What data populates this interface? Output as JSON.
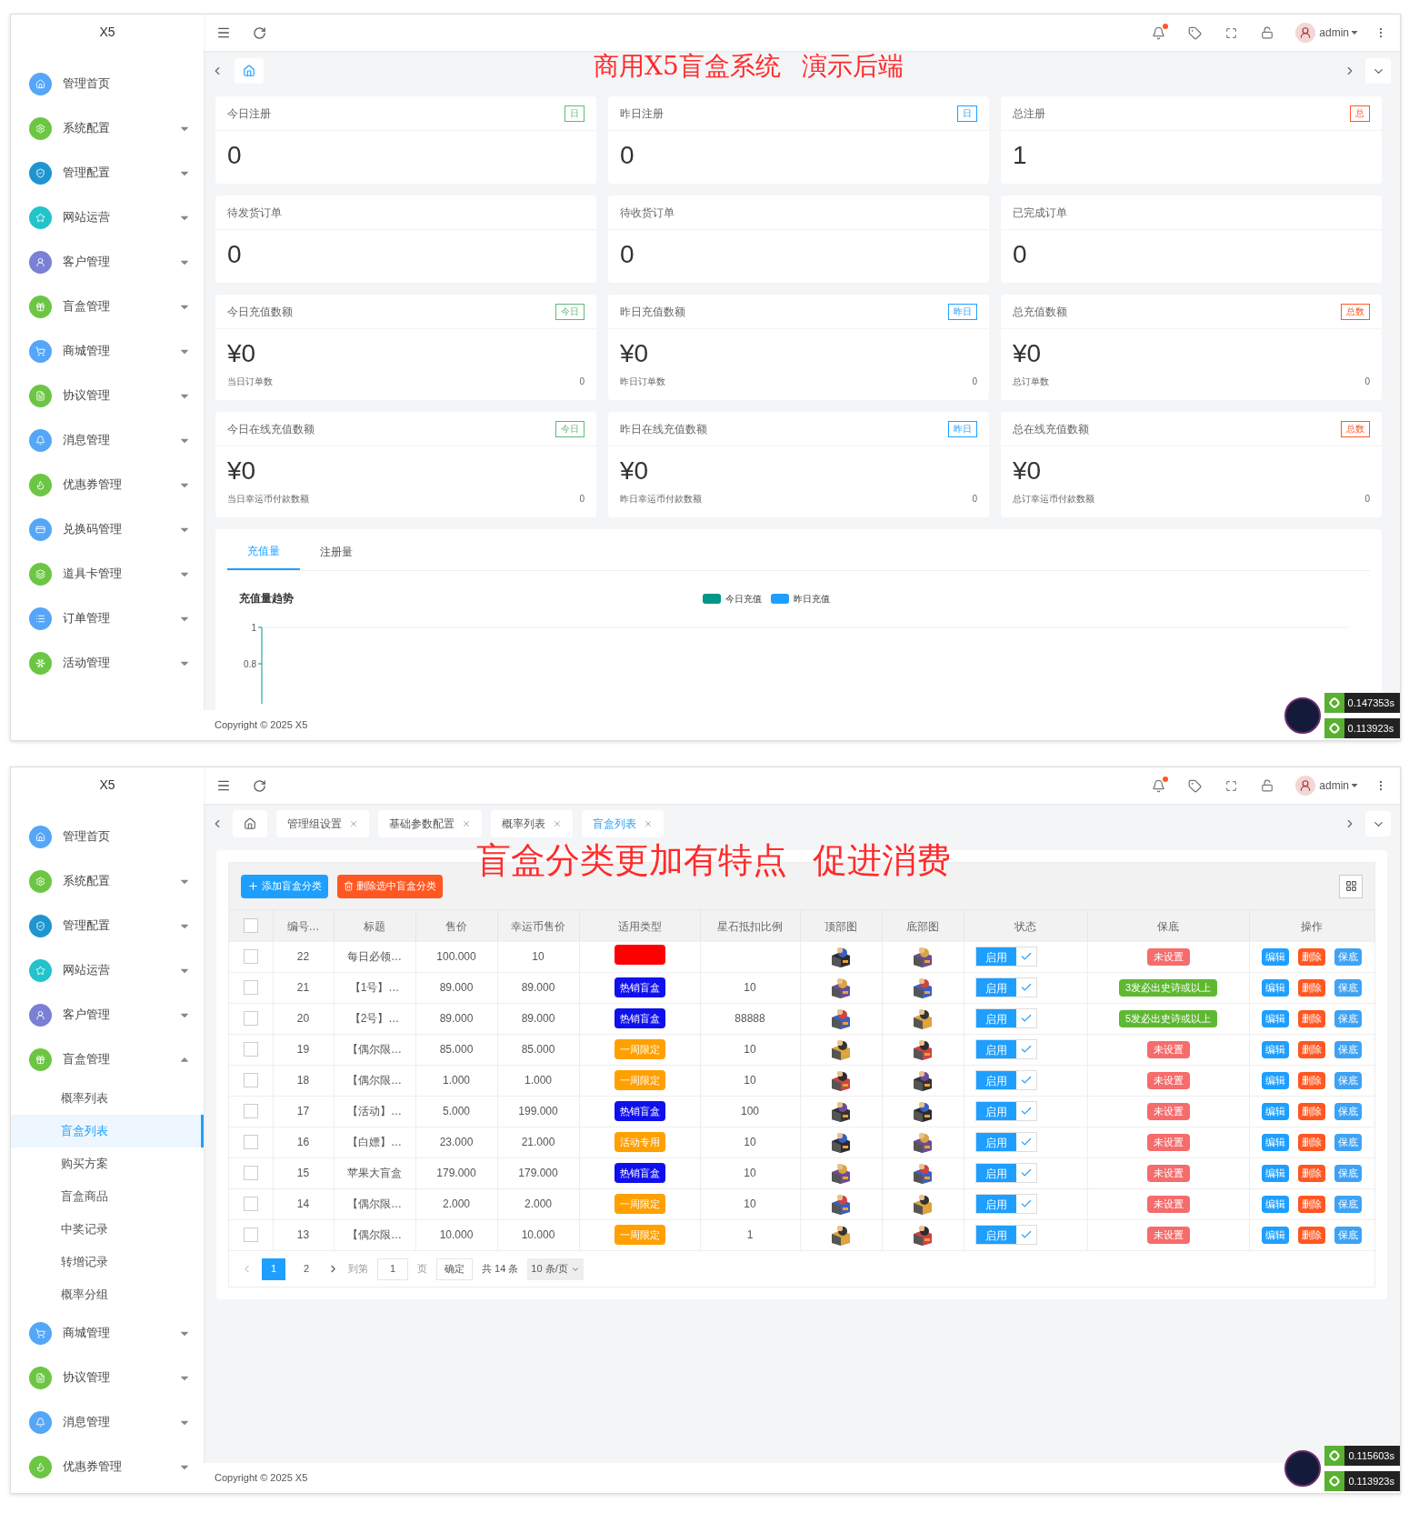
{
  "dashboard_screen": {
    "logo": "X5",
    "header": {
      "user": "admin",
      "notification_dot": true
    },
    "sidebar": [
      {
        "label": "管理首页",
        "color": "#55a6f8",
        "kind": "link"
      },
      {
        "label": "系统配置",
        "color": "#6cc644",
        "kind": "group",
        "expanded": false
      },
      {
        "label": "管理配置",
        "color": "#1f95d0",
        "kind": "group",
        "expanded": false
      },
      {
        "label": "网站运营",
        "color": "#22c3c9",
        "kind": "group",
        "expanded": false
      },
      {
        "label": "客户管理",
        "color": "#7b80d6",
        "kind": "group",
        "expanded": false
      },
      {
        "label": "盲盒管理",
        "color": "#6cc644",
        "kind": "group",
        "expanded": false
      },
      {
        "label": "商城管理",
        "color": "#55a6f8",
        "kind": "group",
        "expanded": false
      },
      {
        "label": "协议管理",
        "color": "#6cc644",
        "kind": "group",
        "expanded": false
      },
      {
        "label": "消息管理",
        "color": "#55a6f8",
        "kind": "group",
        "expanded": false
      },
      {
        "label": "优惠券管理",
        "color": "#6cc644",
        "kind": "group",
        "expanded": false
      },
      {
        "label": "兑换码管理",
        "color": "#55a6f8",
        "kind": "group",
        "expanded": false
      },
      {
        "label": "道具卡管理",
        "color": "#6cc644",
        "kind": "group",
        "expanded": false
      },
      {
        "label": "订单管理",
        "color": "#55a6f8",
        "kind": "group",
        "expanded": false
      },
      {
        "label": "活动管理",
        "color": "#6cc644",
        "kind": "group",
        "expanded": false
      }
    ],
    "caption": "商用X5盲盒系统 演示后端",
    "cards": [
      {
        "kind": "count",
        "title": "今日注册",
        "tag": {
          "text": "日",
          "color": "#5fb878"
        },
        "value": "0"
      },
      {
        "kind": "count",
        "title": "昨日注册",
        "tag": {
          "text": "日",
          "color": "#1e9fff"
        },
        "value": "0"
      },
      {
        "kind": "count",
        "title": "总注册",
        "tag": {
          "text": "总",
          "color": "#ff5722"
        },
        "value": "1"
      },
      {
        "kind": "count",
        "title": "待发货订单",
        "value": "0"
      },
      {
        "kind": "count",
        "title": "待收货订单",
        "value": "0"
      },
      {
        "kind": "count",
        "title": "已完成订单",
        "value": "0"
      },
      {
        "kind": "money",
        "title": "今日充值数额",
        "tag": {
          "text": "今日",
          "color": "#5fb878"
        },
        "value": "¥0",
        "sub_label": "当日订单数",
        "sub_value": "0"
      },
      {
        "kind": "money",
        "title": "昨日充值数额",
        "tag": {
          "text": "昨日",
          "color": "#1e9fff"
        },
        "value": "¥0",
        "sub_label": "昨日订单数",
        "sub_value": "0"
      },
      {
        "kind": "money",
        "title": "总充值数额",
        "tag": {
          "text": "总数",
          "color": "#ff5722"
        },
        "value": "¥0",
        "sub_label": "总订单数",
        "sub_value": "0"
      },
      {
        "kind": "money",
        "title": "今日在线充值数额",
        "tag": {
          "text": "今日",
          "color": "#5fb878"
        },
        "value": "¥0",
        "sub_label": "当日幸运币付款数额",
        "sub_value": "0"
      },
      {
        "kind": "money",
        "title": "昨日在线充值数额",
        "tag": {
          "text": "昨日",
          "color": "#1e9fff"
        },
        "value": "¥0",
        "sub_label": "昨日幸运币付款数额",
        "sub_value": "0"
      },
      {
        "kind": "money",
        "title": "总在线充值数额",
        "tag": {
          "text": "总数",
          "color": "#ff5722"
        },
        "value": "¥0",
        "sub_label": "总订幸运币付款数额",
        "sub_value": "0"
      }
    ],
    "chart_panel": {
      "tabs": [
        {
          "label": "充值量",
          "selected": true
        },
        {
          "label": "注册量",
          "selected": false
        }
      ],
      "title": "充值量趋势",
      "legend": [
        {
          "label": "今日充值",
          "color": "#009688"
        },
        {
          "label": "昨日充值",
          "color": "#1e9fff"
        }
      ],
      "yticks": [
        "1",
        "0.8"
      ]
    },
    "footer": "Copyright © 2025 X5",
    "timings": [
      "0.147353s",
      "0.113923s"
    ]
  },
  "list_screen": {
    "logo": "X5",
    "header": {
      "user": "admin",
      "notification_dot": true
    },
    "sidebar": [
      {
        "label": "管理首页",
        "color": "#55a6f8",
        "kind": "link"
      },
      {
        "label": "系统配置",
        "color": "#6cc644",
        "kind": "group",
        "expanded": false
      },
      {
        "label": "管理配置",
        "color": "#1f95d0",
        "kind": "group",
        "expanded": false
      },
      {
        "label": "网站运营",
        "color": "#22c3c9",
        "kind": "group",
        "expanded": false
      },
      {
        "label": "客户管理",
        "color": "#7b80d6",
        "kind": "group",
        "expanded": false
      },
      {
        "label": "盲盒管理",
        "color": "#6cc644",
        "kind": "group",
        "expanded": true,
        "children": [
          {
            "label": "概率列表",
            "selected": false
          },
          {
            "label": "盲盒列表",
            "selected": true
          },
          {
            "label": "购买方案",
            "selected": false
          },
          {
            "label": "盲盒商品",
            "selected": false
          },
          {
            "label": "中奖记录",
            "selected": false
          },
          {
            "label": "转增记录",
            "selected": false
          },
          {
            "label": "概率分组",
            "selected": false
          }
        ]
      },
      {
        "label": "商城管理",
        "color": "#55a6f8",
        "kind": "group",
        "expanded": false
      },
      {
        "label": "协议管理",
        "color": "#6cc644",
        "kind": "group",
        "expanded": false
      },
      {
        "label": "消息管理",
        "color": "#55a6f8",
        "kind": "group",
        "expanded": false
      },
      {
        "label": "优惠券管理",
        "color": "#6cc644",
        "kind": "group",
        "expanded": false
      }
    ],
    "tabs": [
      {
        "label": "管理组设置",
        "selected": false
      },
      {
        "label": "基础参数配置",
        "selected": false
      },
      {
        "label": "概率列表",
        "selected": false
      },
      {
        "label": "盲盒列表",
        "selected": true
      }
    ],
    "caption": "盲盒分类更加有特点 促进消费",
    "toolbar": {
      "add_button": "添加盲盒分类",
      "delete_button": "删除选中盲盒分类"
    },
    "table": {
      "columns": [
        "编号…",
        "标题",
        "售价",
        "幸运币售价",
        "适用类型",
        "星石抵扣比例",
        "顶部图",
        "底部图",
        "状态",
        "保底",
        "操作"
      ],
      "header_checked": false,
      "rows": [
        {
          "checked": false,
          "id": "22",
          "title": "每日必领…",
          "price": "100.000",
          "coin_price": "10",
          "type_tag": {
            "color": "#ff0000"
          },
          "guarantee": {
            "text": "未设置",
            "color": "#f56c6c"
          },
          "status": {
            "label": "启用",
            "on": true
          },
          "actions": [
            "编辑",
            "删除",
            "保底"
          ]
        },
        {
          "checked": false,
          "id": "21",
          "title": "【1号】…",
          "price": "89.000",
          "coin_price": "89.000",
          "type_tag": {
            "text": "热销盲盒",
            "color": "#1010ee"
          },
          "ratio": "10",
          "guarantee": {
            "text": "3发必出史诗或以上",
            "color": "#5fb832"
          },
          "status": {
            "label": "启用",
            "on": true
          },
          "actions": [
            "编辑",
            "删除",
            "保底"
          ]
        },
        {
          "checked": false,
          "id": "20",
          "title": "【2号】…",
          "price": "89.000",
          "coin_price": "89.000",
          "type_tag": {
            "text": "热销盲盒",
            "color": "#1010ee"
          },
          "ratio": "88888",
          "guarantee": {
            "text": "5发必出史诗或以上",
            "color": "#5fb832"
          },
          "status": {
            "label": "启用",
            "on": true
          },
          "actions": [
            "编辑",
            "删除",
            "保底"
          ]
        },
        {
          "checked": false,
          "id": "19",
          "title": "【偶尔限…",
          "price": "85.000",
          "coin_price": "85.000",
          "type_tag": {
            "text": "一周限定",
            "color": "#ffa000"
          },
          "ratio": "10",
          "guarantee": {
            "text": "未设置",
            "color": "#f56c6c"
          },
          "status": {
            "label": "启用",
            "on": true
          },
          "actions": [
            "编辑",
            "删除",
            "保底"
          ]
        },
        {
          "checked": false,
          "id": "18",
          "title": "【偶尔限…",
          "price": "1.000",
          "coin_price": "1.000",
          "type_tag": {
            "text": "一周限定",
            "color": "#ffa000"
          },
          "ratio": "10",
          "guarantee": {
            "text": "未设置",
            "color": "#f56c6c"
          },
          "status": {
            "label": "启用",
            "on": true
          },
          "actions": [
            "编辑",
            "删除",
            "保底"
          ]
        },
        {
          "checked": false,
          "id": "17",
          "title": "【活动】…",
          "price": "5.000",
          "coin_price": "199.000",
          "type_tag": {
            "text": "热销盲盒",
            "color": "#1010ee"
          },
          "ratio": "100",
          "guarantee": {
            "text": "未设置",
            "color": "#f56c6c"
          },
          "status": {
            "label": "启用",
            "on": true
          },
          "actions": [
            "编辑",
            "删除",
            "保底"
          ]
        },
        {
          "checked": false,
          "id": "16",
          "title": "【白嫖】…",
          "price": "23.000",
          "coin_price": "21.000",
          "type_tag": {
            "text": "活动专用",
            "color": "#ffa000"
          },
          "ratio": "10",
          "guarantee": {
            "text": "未设置",
            "color": "#f56c6c"
          },
          "status": {
            "label": "启用",
            "on": true
          },
          "actions": [
            "编辑",
            "删除",
            "保底"
          ]
        },
        {
          "checked": false,
          "id": "15",
          "title": "苹果大盲盒",
          "price": "179.000",
          "coin_price": "179.000",
          "type_tag": {
            "text": "热销盲盒",
            "color": "#1010ee"
          },
          "ratio": "10",
          "guarantee": {
            "text": "未设置",
            "color": "#f56c6c"
          },
          "status": {
            "label": "启用",
            "on": true
          },
          "actions": [
            "编辑",
            "删除",
            "保底"
          ]
        },
        {
          "checked": false,
          "id": "14",
          "title": "【偶尔限…",
          "price": "2.000",
          "coin_price": "2.000",
          "type_tag": {
            "text": "一周限定",
            "color": "#ffa000"
          },
          "ratio": "10",
          "guarantee": {
            "text": "未设置",
            "color": "#f56c6c"
          },
          "status": {
            "label": "启用",
            "on": true
          },
          "actions": [
            "编辑",
            "删除",
            "保底"
          ]
        },
        {
          "checked": false,
          "id": "13",
          "title": "【偶尔限…",
          "price": "10.000",
          "coin_price": "10.000",
          "type_tag": {
            "text": "一周限定",
            "color": "#ffa000"
          },
          "ratio": "1",
          "guarantee": {
            "text": "未设置",
            "color": "#f56c6c"
          },
          "status": {
            "label": "启用",
            "on": true
          },
          "actions": [
            "编辑",
            "删除",
            "保底"
          ]
        }
      ]
    },
    "pagination": {
      "pages": [
        {
          "label": "1",
          "selected": true
        },
        {
          "label": "2",
          "selected": false
        }
      ],
      "goto_label": "到第",
      "goto_value": "1",
      "page_unit": "页",
      "confirm": "确定",
      "total": "共 14 条",
      "page_size": "10 条/页"
    },
    "footer": "Copyright © 2025 X5",
    "timings": [
      "0.115603s",
      "0.113923s"
    ]
  }
}
